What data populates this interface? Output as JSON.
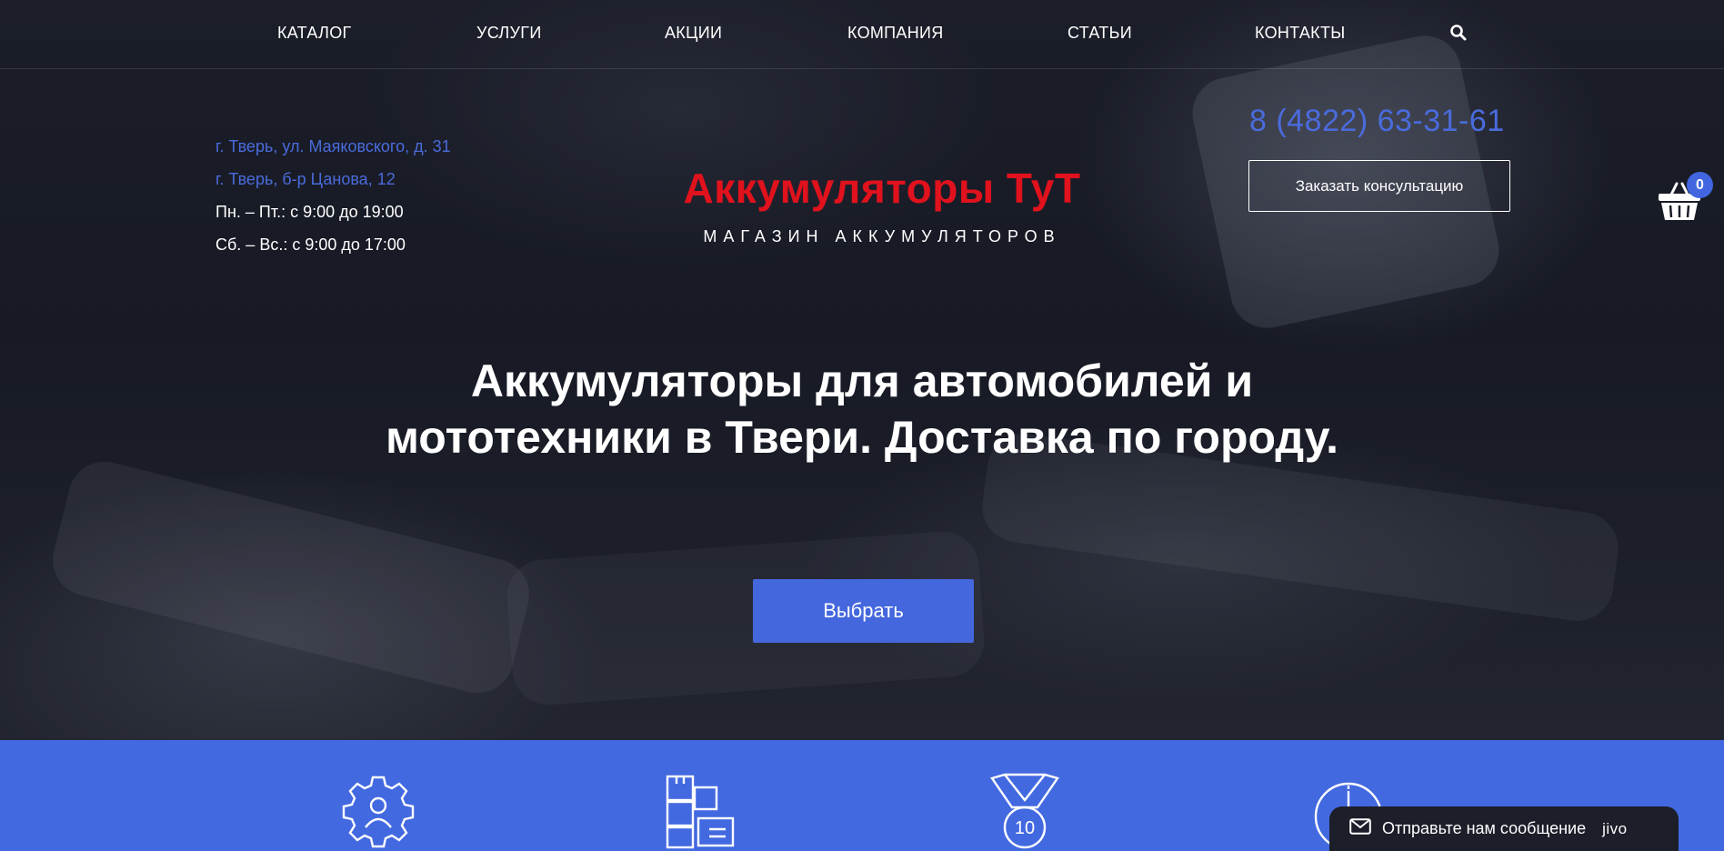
{
  "nav": {
    "items": [
      {
        "label": "КАТАЛОГ"
      },
      {
        "label": "УСЛУГИ"
      },
      {
        "label": "АКЦИИ"
      },
      {
        "label": "КОМПАНИЯ"
      },
      {
        "label": "СТАТЬИ"
      },
      {
        "label": "КОНТАКТЫ"
      }
    ],
    "search_icon": "search-icon"
  },
  "contacts": {
    "address1": "г. Тверь, ул. Маяковского, д. 31",
    "address2": "г. Тверь, б-р Цанова, 12",
    "hours_weekdays": "Пн. – Пт.: с 9:00 до 19:00",
    "hours_weekend": "Сб. – Вс.: с 9:00 до 17:00"
  },
  "logo": {
    "title": "Аккумуляторы ТуТ",
    "subtitle": "МАГАЗИН АККУМУЛЯТОРОВ"
  },
  "header": {
    "phone": "8 (4822) 63-31-61",
    "consult_label": "Заказать консультацию",
    "cart_count": "0"
  },
  "hero": {
    "headline_line1": "Аккумуляторы для автомобилей и",
    "headline_line2": "мототехники в Твери. Доставка по городу.",
    "cta_label": "Выбрать"
  },
  "features": {
    "icons": [
      "gear-person-icon",
      "boxes-icon",
      "medal-10-icon",
      "clock-icon"
    ],
    "medal_number": "10"
  },
  "chat": {
    "label": "Отправьте нам сообщение",
    "brand": "jivo"
  },
  "colors": {
    "accent": "#4369e0",
    "logo_red": "#e0121d",
    "link_blue": "#4a6bdc",
    "background": "#1b1e29"
  }
}
